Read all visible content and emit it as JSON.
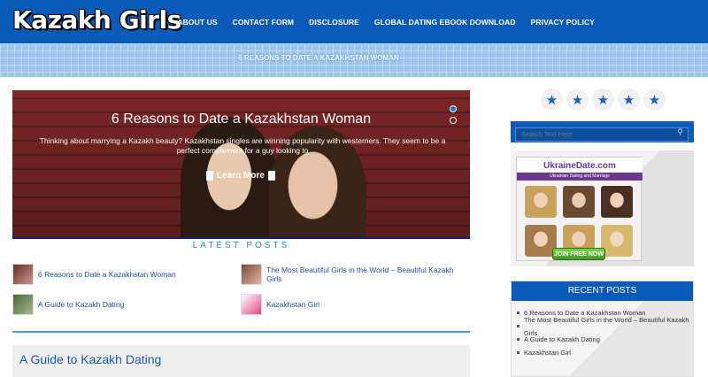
{
  "site": {
    "logo": "Kazakh Girls"
  },
  "nav": [
    "ABOUT US",
    "CONTACT FORM",
    "DISCLOSURE",
    "GLOBAL DATING EBOOK DOWNLOAD",
    "PRIVACY POLICY"
  ],
  "subbar": {
    "text": "6 REASONS TO DATE A KAZAKHSTAN WOMAN"
  },
  "slider": {
    "title": "6 Reasons to Date a Kazakhstan Woman",
    "excerpt": "Thinking about marrying a Kazakh beauty? Kazakhstan singles are winning popularity with westerners. They seem to be a perfect complement for a guy looking to",
    "learn_more": "Learn More"
  },
  "latest": {
    "heading": "LATEST POSTS",
    "posts": [
      "6 Reasons to Date a Kazakhstan Woman",
      "The Most Beautiful Girls in the World – Beautiful Kazakh Girls",
      "A Guide to Kazakh Dating",
      "Kazakhstan Girl"
    ]
  },
  "article": {
    "title": "A Guide to Kazakh Dating"
  },
  "sidebar": {
    "stars": 5,
    "search_placeholder": "Search Text Here",
    "ad": {
      "brand": "UkraineDate.com",
      "tagline": "Ukrainian Dating and Marriage",
      "join": "JOIN FREE NOW"
    },
    "recent": {
      "heading": "RECENT POSTS",
      "items": [
        "6 Reasons to Date a Kazakhstan Woman",
        "The Most Beautiful Girls in the World – Beautiful Kazakh Girls",
        "A Guide to Kazakh Dating",
        "Kazakhstan Girl"
      ]
    }
  },
  "colors": {
    "brand_blue": "#0a5bb8",
    "link": "#1a4f9c",
    "accent": "#3fa3d8"
  }
}
